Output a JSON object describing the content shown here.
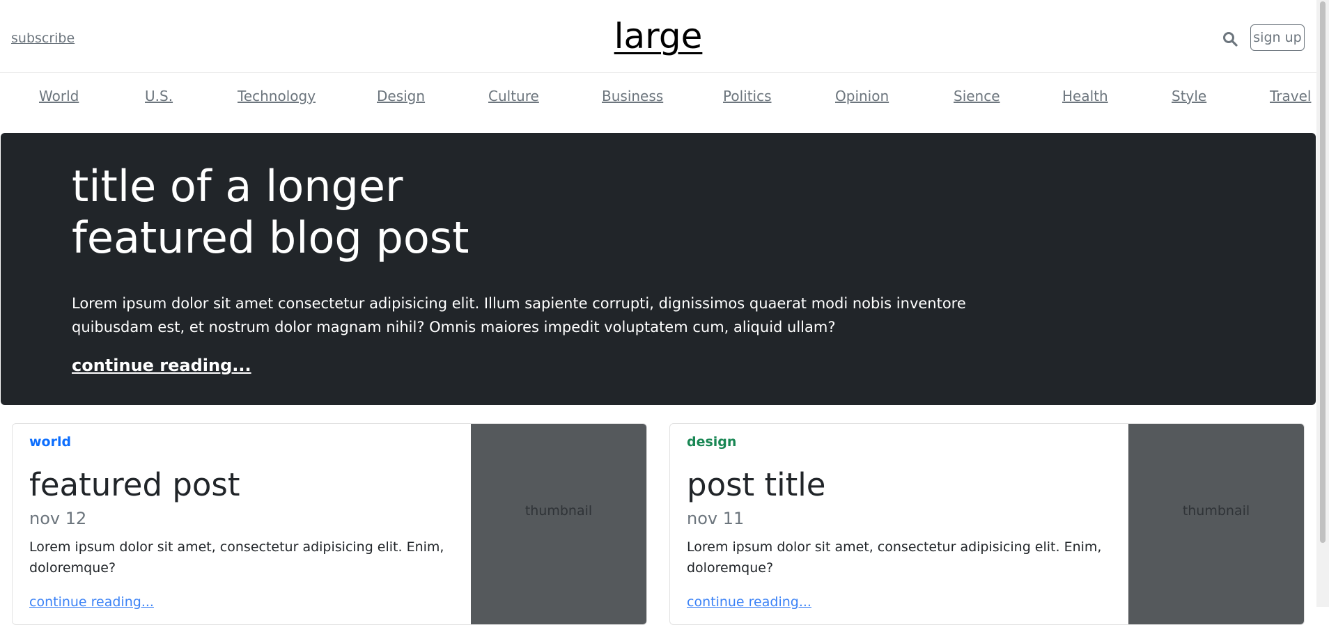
{
  "header": {
    "subscribe_label": "subscribe",
    "logo_text": "large",
    "signup_label": "sign up",
    "search_icon": "search-icon"
  },
  "nav": {
    "items": [
      "World",
      "U.S.",
      "Technology",
      "Design",
      "Culture",
      "Business",
      "Politics",
      "Opinion",
      "Sience",
      "Health",
      "Style",
      "Travel"
    ]
  },
  "hero": {
    "title": "title of a longer featured blog post",
    "text": "Lorem ipsum dolor sit amet consectetur adipisicing elit. Illum sapiente corrupti, dignissimos quaerat modi nobis inventore quibusdam est, et nostrum dolor magnam nihil? Omnis maiores impedit voluptatem cum, aliquid ullam?",
    "link_label": "continue reading..."
  },
  "cards": [
    {
      "category": "world",
      "category_color": "#0d6efd",
      "title": "featured post",
      "date": "nov 12",
      "text": "Lorem ipsum dolor sit amet, consectetur adipisicing elit. Enim, doloremque?",
      "link_label": "continue reading...",
      "thumbnail_label": "thumbnail"
    },
    {
      "category": "design",
      "category_color": "#198754",
      "title": "post title",
      "date": "nov 11",
      "text": "Lorem ipsum dolor sit amet, consectetur adipisicing elit. Enim, doloremque?",
      "link_label": "continue reading...",
      "thumbnail_label": "thumbnail"
    }
  ],
  "colors": {
    "hero_bg": "#212529",
    "muted": "#6c757d",
    "thumb_bg": "#55595c",
    "link_blue": "#3b82f6"
  }
}
